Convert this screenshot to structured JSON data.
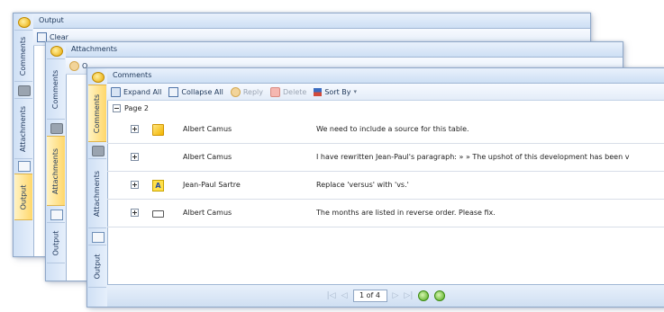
{
  "windows": [
    {
      "title": "Output",
      "toolbar_fragment": "Clear",
      "side_tabs": [
        "Comments",
        "Attachments",
        "Output"
      ]
    },
    {
      "title": "Attachments",
      "toolbar_fragment": "O",
      "side_tabs": [
        "Comments",
        "Attachments",
        "Output"
      ]
    },
    {
      "title": "Comments",
      "side_tabs": [
        "Comments",
        "Attachments",
        "Output"
      ],
      "toolbar": {
        "expand_all": "Expand All",
        "collapse_all": "Collapse All",
        "reply": "Reply",
        "delete": "Delete",
        "sort_by": "Sort By"
      },
      "group_label": "Page 2",
      "comments": [
        {
          "author": "Albert Camus",
          "text": "We need to include a source for this table.",
          "icon": "sticky-note-icon"
        },
        {
          "author": "Albert Camus",
          "text": "I have rewritten Jean-Paul's paragraph: » » The upshot of this development has been v",
          "icon": "none"
        },
        {
          "author": "Jean-Paul Sartre",
          "text": "Replace 'versus' with 'vs.'",
          "icon": "text-attribute-icon"
        },
        {
          "author": "Albert Camus",
          "text": "The months are listed in reverse order. Please fix.",
          "icon": "textbox-icon"
        }
      ],
      "pager": {
        "page_text": "1 of 4"
      },
      "attribute_glyph": "A"
    }
  ]
}
